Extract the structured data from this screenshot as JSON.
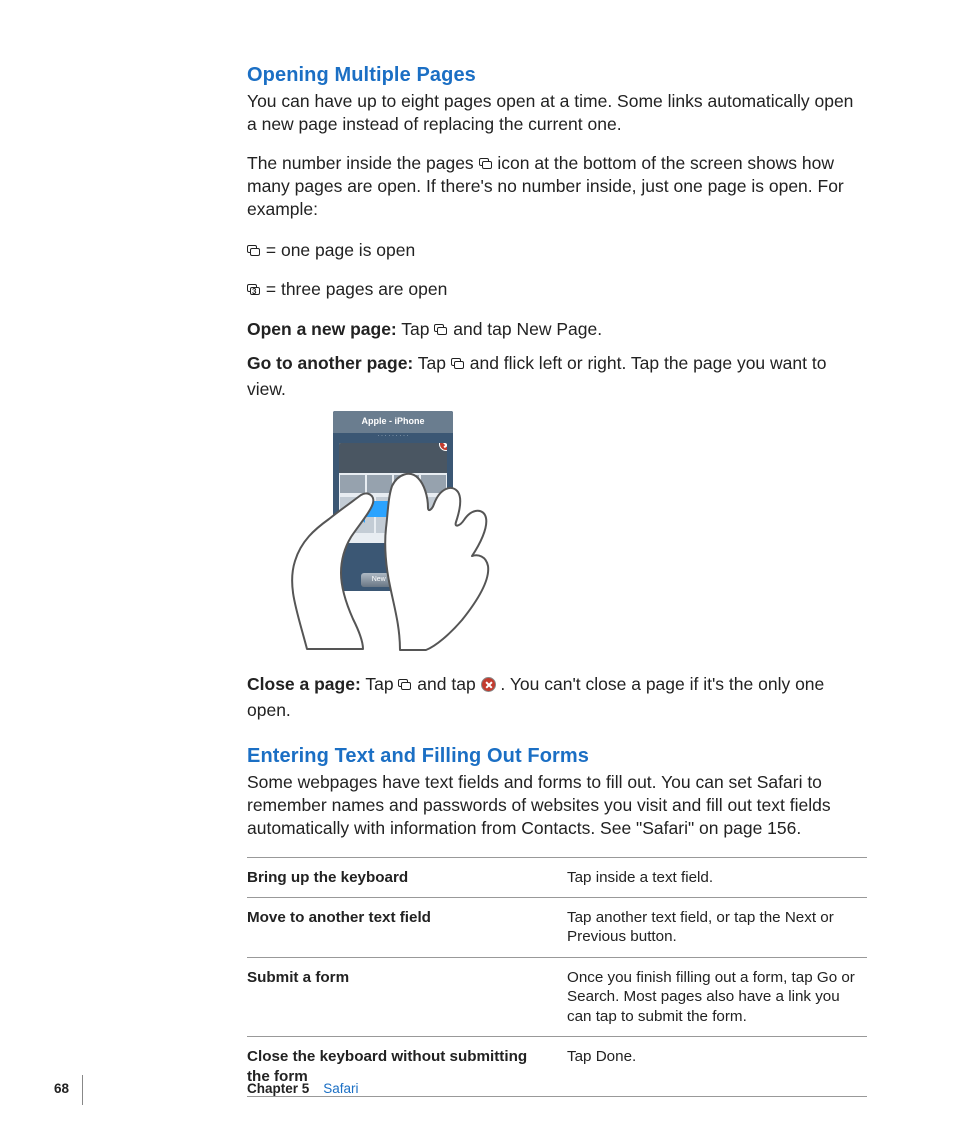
{
  "section1": {
    "heading": "Opening Multiple Pages",
    "p1": "You can have up to eight pages open at a time. Some links automatically open a new page instead of replacing the current one.",
    "p2a": "The number inside the pages ",
    "p2b": " icon at the bottom of the screen shows how many pages are open. If there's no number inside, just one page is open. For example:",
    "ex1": " = one page is open",
    "ex2": " = three pages are open",
    "open_label": "Open a new page:",
    "open_a": "  Tap ",
    "open_b": " and tap New Page.",
    "goto_label": "Go to another page:",
    "goto_a": "  Tap ",
    "goto_b": " and flick left or right. Tap the page you want to view.",
    "figure_title": "Apple - iPhone",
    "figure_newpage": "New P",
    "close_label": "Close a page:",
    "close_a": "  Tap ",
    "close_b": " and tap ",
    "close_c": ". You can't close a page if it's the only one open."
  },
  "section2": {
    "heading": "Entering Text and Filling Out Forms",
    "p1": "Some webpages have text fields and forms to fill out. You can set Safari to remember names and passwords of websites you visit and fill out text fields automatically with information from Contacts. See \"Safari\" on page 156.",
    "rows": [
      {
        "l": "Bring up the keyboard",
        "r": "Tap inside a text field."
      },
      {
        "l": "Move to another text field",
        "r": "Tap another text field, or tap the Next or Previous button."
      },
      {
        "l": "Submit a form",
        "r": "Once you finish filling out a form, tap Go or Search. Most pages also have a link you can tap to submit the form."
      },
      {
        "l": "Close the keyboard without submitting the form",
        "r": "Tap Done."
      }
    ]
  },
  "footer": {
    "page": "68",
    "chapter": "Chapter 5",
    "title": "Safari"
  }
}
